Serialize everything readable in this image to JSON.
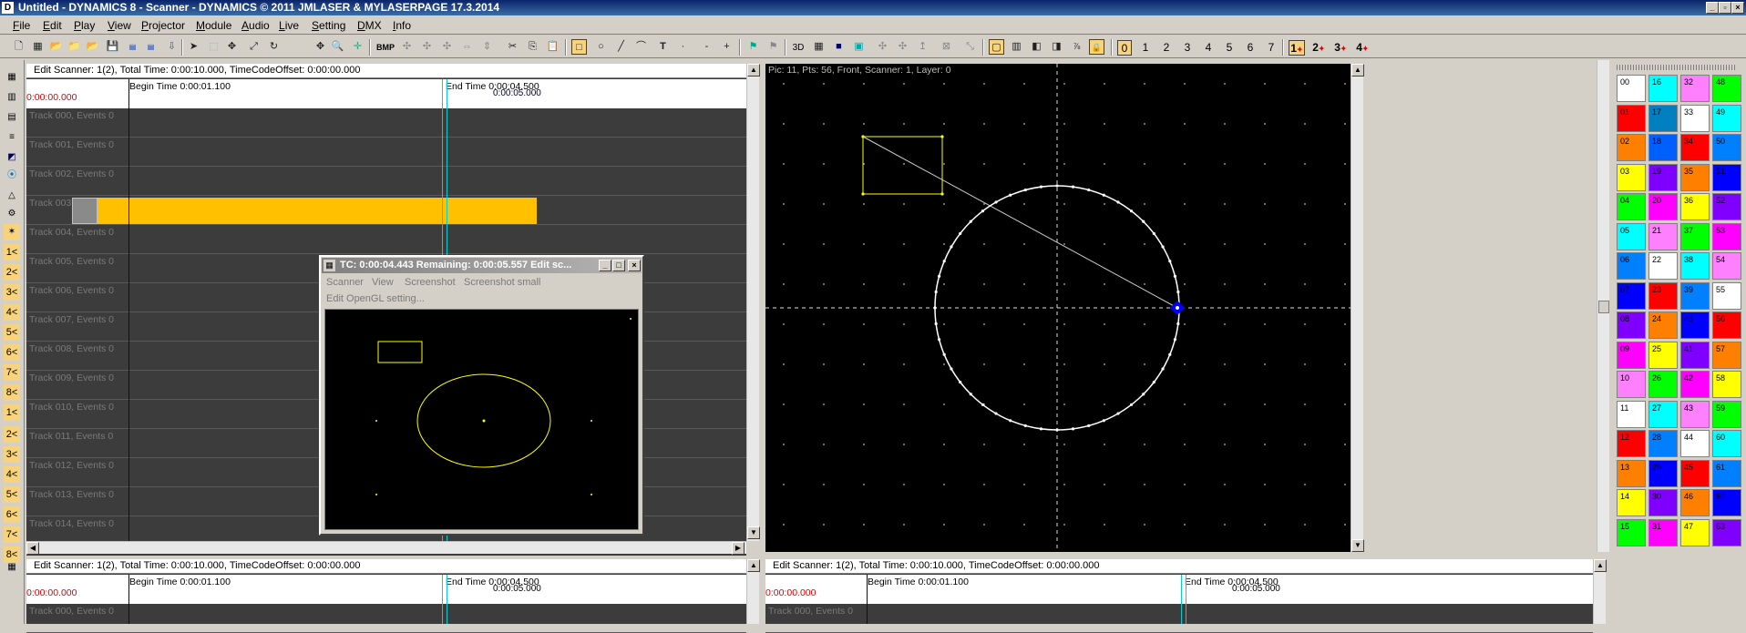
{
  "window": {
    "title": "Untitled - DYNAMICS 8 - Scanner - DYNAMICS © 2011 JMLASER & MYLASERPAGE 17.3.2014",
    "app_icon": "D"
  },
  "menu": [
    {
      "label": "File",
      "ul": "F",
      "rest": "ile"
    },
    {
      "label": "Edit",
      "ul": "E",
      "rest": "dit"
    },
    {
      "label": "Play",
      "ul": "P",
      "rest": "lay"
    },
    {
      "label": "View",
      "ul": "V",
      "rest": "iew"
    },
    {
      "label": "Projector",
      "ul": "P",
      "rest": "rojector"
    },
    {
      "label": "Module",
      "ul": "M",
      "rest": "odule"
    },
    {
      "label": "Audio",
      "ul": "A",
      "rest": "udio"
    },
    {
      "label": "Live",
      "ul": "L",
      "rest": "ive"
    },
    {
      "label": "Setting",
      "ul": "S",
      "rest": "etting"
    },
    {
      "label": "DMX",
      "ul": "D",
      "rest": "MX"
    },
    {
      "label": "Info",
      "ul": "I",
      "rest": "nfo"
    }
  ],
  "toolbar": {
    "bmp": "BMP",
    "threed": "3D",
    "numbers": [
      "0",
      "1",
      "2",
      "3",
      "4",
      "5",
      "6",
      "7"
    ],
    "layers": [
      "1",
      "2",
      "3",
      "4"
    ]
  },
  "left_tools": [
    "1<",
    "2<",
    "3<",
    "4<",
    "5<",
    "6<",
    "7<",
    "8<",
    "1<",
    "2<",
    "3<",
    "4<",
    "5<",
    "6<",
    "7<",
    "8<"
  ],
  "timeline_top": {
    "header": "Edit Scanner: 1(2), Total Time: 0:00:10.000, TimeCodeOffset: 0:00:00.000",
    "time_start": "0:00:00.000",
    "begin": "Begin Time 0:00:01.100",
    "end": "End Time 0:00:04.500",
    "cursor": "0:00:05.000",
    "tracks": [
      "Track 000, Events 0",
      "Track 001, Events 0",
      "Track 002, Events 0",
      "Track 003, Events 1",
      "Track 004, Events 0",
      "Track 005, Events 0",
      "Track 006, Events 0",
      "Track 007, Events 0",
      "Track 008, Events 0",
      "Track 009, Events 0",
      "Track 010, Events 0",
      "Track 011, Events 0",
      "Track 012, Events 0",
      "Track 013, Events 0",
      "Track 014, Events 0"
    ]
  },
  "laser_view": {
    "info": "Pic: 11, Pts: 56, Front, Scanner: 1, Layer: 0"
  },
  "float_window": {
    "title": "TC: 0:00:04.443   Remaining: 0:00:05.557   Edit sc...",
    "menu": [
      "Scanner",
      "View",
      "Screenshot",
      "Screenshot small"
    ],
    "menu2": "Edit OpenGL setting..."
  },
  "timeline_bottom_left": {
    "header": "Edit Scanner: 1(2), Total Time: 0:00:10.000, TimeCodeOffset: 0:00:00.000",
    "time_start": "0:00:00.000",
    "begin": "Begin Time 0:00:01.100",
    "end": "End Time 0:00:04.500",
    "cursor": "0:00:05.000",
    "track": "Track 000, Events 0"
  },
  "timeline_bottom_right": {
    "header": "Edit Scanner: 1(2), Total Time: 0:00:10.000, TimeCodeOffset: 0:00:00.000",
    "time_start": "0:00:00.000",
    "begin": "Begin Time 0:00:01.100",
    "end": "End Time 0:00:04.500",
    "cursor": "0:00:05.000",
    "track": "Track 000, Events 0"
  },
  "palette": [
    {
      "n": "00",
      "c": "#ffffff"
    },
    {
      "n": "16",
      "c": "#00ffff"
    },
    {
      "n": "32",
      "c": "#ff80ff"
    },
    {
      "n": "48",
      "c": "#00ff00"
    },
    {
      "n": "01",
      "c": "#ff0000"
    },
    {
      "n": "17",
      "c": "#0080c0"
    },
    {
      "n": "33",
      "c": "#ffffff"
    },
    {
      "n": "49",
      "c": "#00ffff"
    },
    {
      "n": "02",
      "c": "#ff8000"
    },
    {
      "n": "18",
      "c": "#0060ff"
    },
    {
      "n": "34",
      "c": "#ff0000"
    },
    {
      "n": "50",
      "c": "#0080ff"
    },
    {
      "n": "03",
      "c": "#ffff00"
    },
    {
      "n": "19",
      "c": "#8000ff"
    },
    {
      "n": "35",
      "c": "#ff8000"
    },
    {
      "n": "51",
      "c": "#0000ff"
    },
    {
      "n": "04",
      "c": "#00ff00"
    },
    {
      "n": "20",
      "c": "#ff00ff"
    },
    {
      "n": "36",
      "c": "#ffff00"
    },
    {
      "n": "52",
      "c": "#8000ff"
    },
    {
      "n": "05",
      "c": "#00ffff"
    },
    {
      "n": "21",
      "c": "#ff80ff"
    },
    {
      "n": "37",
      "c": "#00ff00"
    },
    {
      "n": "53",
      "c": "#ff00ff"
    },
    {
      "n": "06",
      "c": "#0080ff"
    },
    {
      "n": "22",
      "c": "#ffffff"
    },
    {
      "n": "38",
      "c": "#00ffff"
    },
    {
      "n": "54",
      "c": "#ff80ff"
    },
    {
      "n": "07",
      "c": "#0000ff"
    },
    {
      "n": "23",
      "c": "#ff0000"
    },
    {
      "n": "39",
      "c": "#0080ff"
    },
    {
      "n": "55",
      "c": "#ffffff"
    },
    {
      "n": "08",
      "c": "#8000ff"
    },
    {
      "n": "24",
      "c": "#ff8000"
    },
    {
      "n": "40",
      "c": "#0000ff"
    },
    {
      "n": "56",
      "c": "#ff0000"
    },
    {
      "n": "09",
      "c": "#ff00ff"
    },
    {
      "n": "25",
      "c": "#ffff00"
    },
    {
      "n": "41",
      "c": "#8000ff"
    },
    {
      "n": "57",
      "c": "#ff8000"
    },
    {
      "n": "10",
      "c": "#ff80ff"
    },
    {
      "n": "26",
      "c": "#00ff00"
    },
    {
      "n": "42",
      "c": "#ff00ff"
    },
    {
      "n": "58",
      "c": "#ffff00"
    },
    {
      "n": "11",
      "c": "#ffffff"
    },
    {
      "n": "27",
      "c": "#00ffff"
    },
    {
      "n": "43",
      "c": "#ff80ff"
    },
    {
      "n": "59",
      "c": "#00ff00"
    },
    {
      "n": "12",
      "c": "#ff0000"
    },
    {
      "n": "28",
      "c": "#0080ff"
    },
    {
      "n": "44",
      "c": "#ffffff"
    },
    {
      "n": "60",
      "c": "#00ffff"
    },
    {
      "n": "13",
      "c": "#ff8000"
    },
    {
      "n": "29",
      "c": "#0000ff"
    },
    {
      "n": "45",
      "c": "#ff0000"
    },
    {
      "n": "61",
      "c": "#0080ff"
    },
    {
      "n": "14",
      "c": "#ffff00"
    },
    {
      "n": "30",
      "c": "#8000ff"
    },
    {
      "n": "46",
      "c": "#ff8000"
    },
    {
      "n": "62",
      "c": "#0000ff"
    },
    {
      "n": "15",
      "c": "#00ff00"
    },
    {
      "n": "31",
      "c": "#ff00ff"
    },
    {
      "n": "47",
      "c": "#ffff00"
    },
    {
      "n": "63",
      "c": "#8000ff"
    }
  ]
}
